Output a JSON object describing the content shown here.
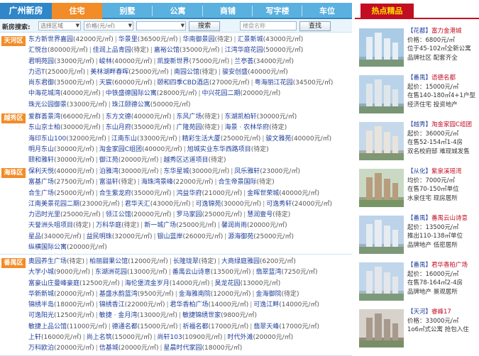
{
  "nav": {
    "brand": "广州新房",
    "tabs": [
      "住宅",
      "别墅",
      "公寓",
      "商铺",
      "写字楼",
      "车位"
    ],
    "active": 0
  },
  "search": {
    "label": "新房搜索:",
    "district": "选择区域",
    "price": "价格(元/㎡)",
    "type": "",
    "button": "搜索",
    "keyword_placeholder": "楼盘名称",
    "find": "查找"
  },
  "regions": [
    {
      "name": "天河区",
      "lines": [
        [
          [
            "东方新世界嘉园",
            "(42000元/㎡)"
          ],
          [
            "华景里",
            "(36500元/㎡)"
          ],
          [
            "华南御景园",
            "(待定)"
          ],
          [
            "汇景新城",
            "(43000元/㎡)"
          ]
        ],
        [
          [
            "汇悦台",
            "(80000元/㎡)"
          ],
          [
            "佳润上品青园",
            "(待定)"
          ],
          [
            "嘉裕公馆",
            "(35000元/㎡)"
          ],
          [
            "江湾华庭花园",
            "(50000元/㎡)"
          ]
        ],
        [
          [
            "君明苑园",
            "(33000元/㎡)"
          ],
          [
            "峻林",
            "(40000元/㎡)"
          ],
          [
            "凯旋新世界",
            "(75000元/㎡)"
          ],
          [
            "兰亭荟",
            "(34000元/㎡)"
          ]
        ],
        [
          [
            "力迅T",
            "(25000元/㎡)"
          ],
          [
            "美林湖畔春晖",
            "(25000元/㎡)"
          ],
          [
            "南园公馆",
            "(待定)"
          ],
          [
            "骏安创盛",
            "(40000元/㎡)"
          ]
        ],
        [
          [
            "尚东君御",
            "(35000元/㎡)"
          ],
          [
            "天宸",
            "(60000元/㎡)"
          ],
          [
            "颐和四季CBD酒店",
            "(27000元/㎡)"
          ],
          [
            "粤海丽江花园",
            "(34500元/㎡)"
          ]
        ],
        [
          [
            "中海花城湾",
            "(40000元/㎡)"
          ],
          [
            "中铁盛德国际公寓",
            "(28000元/㎡)"
          ],
          [
            "中兴花园二期",
            "(20000元/㎡)"
          ]
        ],
        [
          [
            "珠光公园御景",
            "(33000元/㎡)"
          ],
          [
            "珠江颐德公寓",
            "(50000元/㎡)"
          ]
        ]
      ]
    },
    {
      "name": "越秀区",
      "lines": [
        [
          [
            "爱群荟景湾",
            "(66000元/㎡)"
          ],
          [
            "东方文德",
            "(40000元/㎡)"
          ],
          [
            "东风广场",
            "(待定)"
          ],
          [
            "东湖凯柏轩",
            "(30000元/㎡)"
          ]
        ],
        [
          [
            "东山京士柏",
            "(30000元/㎡)"
          ],
          [
            "东山月府",
            "(35000元/㎡)"
          ],
          [
            "广隆苑园",
            "(待定)"
          ],
          [
            "海景 · 农林华府",
            "(待定)"
          ]
        ],
        [
          [
            "海印东山100",
            "(32000元/㎡)"
          ],
          [
            "江南东山",
            "(33000元/㎡)"
          ],
          [
            "精彩生活大厦",
            "(25000元/㎡)"
          ],
          [
            "骏文雅苑",
            "(40000元/㎡)"
          ]
        ],
        [
          [
            "明月东山",
            "(30000元/㎡)"
          ],
          [
            "淘金家园C组团",
            "(40000元/㎡)"
          ],
          [
            "旭城实业东华西路项目",
            "(待定)"
          ]
        ],
        [
          [
            "颐和雅轩",
            "(30000元/㎡)"
          ],
          [
            "御江苑",
            "(20000元/㎡)"
          ],
          [
            "越秀区达道项目",
            "(待定)"
          ]
        ]
      ]
    },
    {
      "name": "海珠区",
      "lines": [
        [
          [
            "保利天悦",
            "(40000元/㎡)"
          ],
          [
            "泊雅湾",
            "(30000元/㎡)"
          ],
          [
            "东华星城",
            "(30000元/㎡)"
          ],
          [
            "凤乐雅轩",
            "(23000元/㎡)"
          ]
        ],
        [
          [
            "富基广场",
            "(27500元/㎡)"
          ],
          [
            "富溢轩",
            "(待定)"
          ],
          [
            "海珠湾景峰",
            "(22000元/㎡)"
          ],
          [
            "合生帝景国际",
            "(待定)"
          ]
        ],
        [
          [
            "合生广场",
            "(25000元/㎡)"
          ],
          [
            "合生紫龙府",
            "(35000元/㎡)"
          ],
          [
            "鸿益华府",
            "(21000元/㎡)"
          ],
          [
            "金晖世荣城",
            "(40000元/㎡)"
          ]
        ],
        [
          [
            "江南美景花园二期",
            "(23000元/㎡)"
          ],
          [
            "君华天汇",
            "(43000元/㎡)"
          ],
          [
            "可逸锦苑",
            "(30000元/㎡)"
          ],
          [
            "可逸秀轩",
            "(24000元/㎡)"
          ]
        ],
        [
          [
            "力迅时光里",
            "(25000元/㎡)"
          ],
          [
            "领江公馆",
            "(20000元/㎡)"
          ],
          [
            "罗马家园",
            "(25000元/㎡)"
          ],
          [
            "慧润壹号",
            "(待定)"
          ]
        ],
        [
          [
            "天誉洲头咀项目",
            "(待定)"
          ],
          [
            "万科华庭",
            "(待定)"
          ],
          [
            "新一城广场",
            "(25000元/㎡)"
          ],
          [
            "馨润尚雨",
            "(20000元/㎡)"
          ]
        ],
        [
          [
            "星品",
            "(34000元/㎡)"
          ],
          [
            "益民明珠",
            "(32000元/㎡)"
          ],
          [
            "银山蓝岸",
            "(26000元/㎡)"
          ],
          [
            "源海御苑",
            "(25000元/㎡)"
          ]
        ],
        [
          [
            "纵横国际公寓",
            "(20000元/㎡)"
          ]
        ]
      ]
    },
    {
      "name": "番禺区",
      "lines": [
        [
          [
            "奥园养生广场",
            "(待定)"
          ],
          [
            "柏丽甜果公馆",
            "(12000元/㎡)"
          ],
          [
            "长隆珑翠",
            "(待定)"
          ],
          [
            "大商绿庭雅园",
            "(6200元/㎡)"
          ]
        ],
        [
          [
            "大学小城",
            "(9000元/㎡)"
          ],
          [
            "东湖洲花园",
            "(13000元/㎡)"
          ],
          [
            "番禺云山诗意",
            "(13500元/㎡)"
          ],
          [
            "翡翠蓝湾",
            "(7250元/㎡)"
          ]
        ],
        [
          [
            "富豪山庄曼峰豪庭",
            "(12500元/㎡)"
          ],
          [
            "海伦堡流金岁月",
            "(14000元/㎡)"
          ],
          [
            "昊龙花园",
            "(13000元/㎡)"
          ]
        ],
        [
          [
            "华新新城",
            "(20000元/㎡)"
          ],
          [
            "基盛水韵蓝湾",
            "(9500元/㎡)"
          ],
          [
            "金海雅南院",
            "(12000元/㎡)"
          ],
          [
            "金海御院",
            "(待定)"
          ]
        ],
        [
          [
            "锦绣半岛",
            "(18000元/㎡)"
          ],
          [
            "锦绣香江",
            "(22000元/㎡)"
          ],
          [
            "君华香柏广场",
            "(14000元/㎡)"
          ],
          [
            "可逸江畔",
            "(14000元/㎡)"
          ]
        ],
        [
          [
            "可逸阳光",
            "(12500元/㎡)"
          ],
          [
            "敏捷 · 金月湾",
            "(13000元/㎡)"
          ],
          [
            "敏捷锦绣世家",
            "(9800元/㎡)"
          ]
        ],
        [
          [
            "敏捷上品公馆",
            "(11000元/㎡)"
          ],
          [
            "德通名都",
            "(15000元/㎡)"
          ],
          [
            "祈福名都",
            "(17000元/㎡)"
          ],
          [
            "翡翠天峰",
            "(17000元/㎡)"
          ]
        ],
        [
          [
            "上轩",
            "(16000元/㎡)"
          ],
          [
            "尚上名筑",
            "(15000元/㎡)"
          ],
          [
            "尚轩103",
            "(10900元/㎡)"
          ],
          [
            "时代外滩",
            "(20000元/㎡)"
          ]
        ],
        [
          [
            "万科欧泊",
            "(20000元/㎡)"
          ],
          [
            "信基城",
            "(20000元/㎡)"
          ],
          [
            "星晨时代家园",
            "(18000元/㎡)"
          ]
        ]
      ]
    }
  ],
  "hot": {
    "title": "热点精品",
    "cards": [
      {
        "title_tag": "【花都】",
        "title": "富力金港城",
        "l2": "价格：6800元/㎡",
        "l3": "位于45-102㎡全新公寓",
        "l4": "品牌社区 配套齐全"
      },
      {
        "title_tag": "【番禺】",
        "title": "语德名都",
        "l2": "起价：15000元/㎡",
        "l3": "在售140-180㎡4+1户型",
        "l4": "经济住宅 投资地产"
      },
      {
        "title_tag": "【越秀】",
        "title": "淘金家园C组团",
        "l2": "起价：36000元/㎡",
        "l3": "在售52-154㎡1-4房",
        "l4": "双名校府邸 难现城发售"
      },
      {
        "title_tag": "【从化】",
        "title": "紫泉溪瑶湾",
        "l2": "均价：7000元/㎡",
        "l3": "在售70-150㎡单位",
        "l4": "水泉住宅 现房居所"
      },
      {
        "title_tag": "【番禺】",
        "title": "番禺云山诗意",
        "l2": "起价：13500元/㎡",
        "l3": "推出110-138㎡单位",
        "l4": "品牌地产 低密居所"
      },
      {
        "title_tag": "【番禺】",
        "title": "君华香柏广场",
        "l2": "起价：16000元/㎡",
        "l3": "在售78-164㎡2-4房",
        "l4": "品牌地产 景观居所"
      },
      {
        "title_tag": "【天河】",
        "title": "睿峰17",
        "l2": "价格：33000元/㎡",
        "l3": "1o6㎡式公寓 抢包入住",
        "l4": ""
      }
    ]
  }
}
